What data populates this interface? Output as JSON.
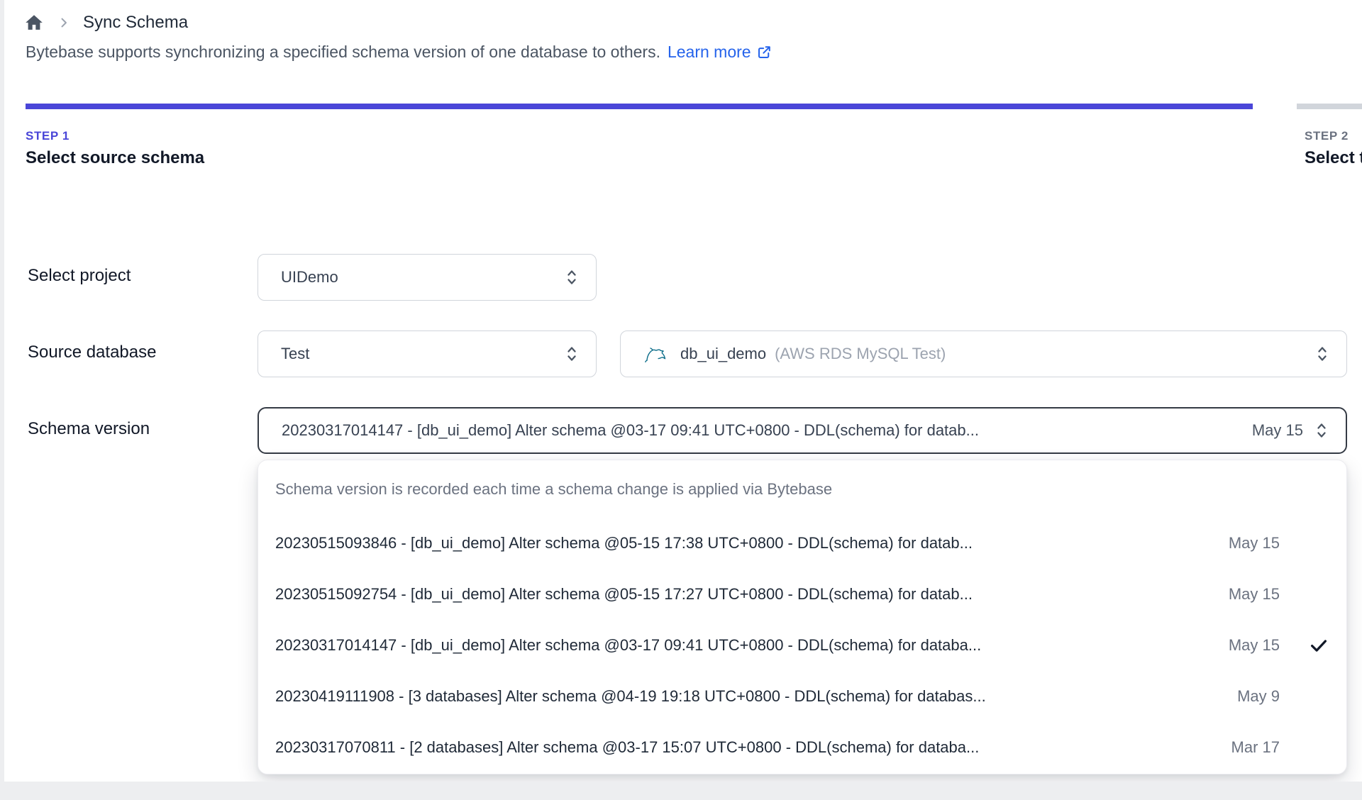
{
  "colors": {
    "accent_indigo": "#4a46d8",
    "link_blue": "#2563eb",
    "focus_border": "#353b45",
    "inactive_bar": "#d1d5db",
    "muted_text": "#6b7280"
  },
  "breadcrumb": {
    "title": "Sync Schema"
  },
  "intro": {
    "text": "Bytebase supports synchronizing a specified schema version of one database to others.",
    "link_label": "Learn more"
  },
  "steps": [
    {
      "label": "STEP 1",
      "title": "Select source schema",
      "active": true
    },
    {
      "label": "STEP 2",
      "title": "Select t",
      "active": false
    }
  ],
  "form": {
    "project": {
      "label": "Select project",
      "value": "UIDemo"
    },
    "source_database": {
      "label": "Source database",
      "environment_value": "Test",
      "database_name": "db_ui_demo",
      "database_instance": "(AWS RDS MySQL Test)"
    },
    "schema_version": {
      "label": "Schema version",
      "value": "20230317014147 - [db_ui_demo] Alter schema @03-17 09:41 UTC+0800 - DDL(schema) for datab...",
      "date": "May 15"
    }
  },
  "dropdown": {
    "hint": "Schema version is recorded each time a schema change is applied via Bytebase",
    "options": [
      {
        "text": "20230515093846 - [db_ui_demo] Alter schema @05-15 17:38 UTC+0800 - DDL(schema) for datab...",
        "date": "May 15",
        "selected": false
      },
      {
        "text": "20230515092754 - [db_ui_demo] Alter schema @05-15 17:27 UTC+0800 - DDL(schema) for datab...",
        "date": "May 15",
        "selected": false
      },
      {
        "text": "20230317014147 - [db_ui_demo] Alter schema @03-17 09:41 UTC+0800 - DDL(schema) for databa...",
        "date": "May 15",
        "selected": true
      },
      {
        "text": "20230419111908 - [3 databases] Alter schema @04-19 19:18 UTC+0800 - DDL(schema) for databas...",
        "date": "May 9",
        "selected": false
      },
      {
        "text": "20230317070811 - [2 databases] Alter schema @03-17 15:07 UTC+0800 - DDL(schema) for databa...",
        "date": "Mar 17",
        "selected": false
      }
    ]
  },
  "icons": {
    "home": "home-icon",
    "breadcrumb_sep": "chevron-right-icon",
    "external_link": "external-link-icon",
    "select_arrows": "chevrons-up-down-icon",
    "mysql": "mysql-dolphin-icon",
    "selected_check": "check-icon"
  }
}
